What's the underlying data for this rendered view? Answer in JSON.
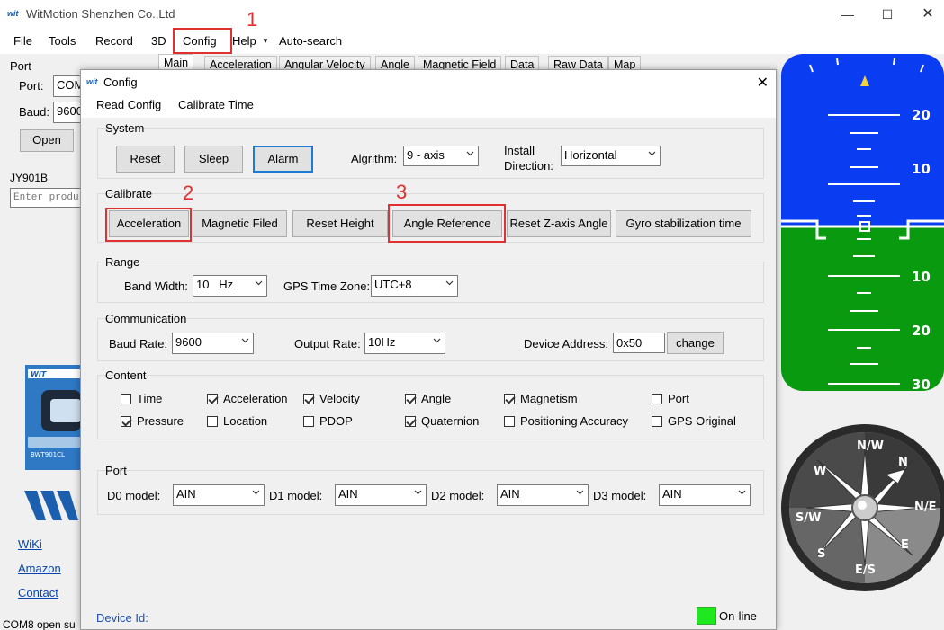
{
  "window": {
    "title": "WitMotion Shenzhen Co.,Ltd",
    "logo": "wit"
  },
  "menubar": [
    "File",
    "Tools",
    "Record",
    "3D",
    "Config",
    "Help",
    "Auto-search"
  ],
  "annotations": [
    "1",
    "2",
    "3"
  ],
  "left_panel": {
    "port_group": "Port",
    "port_label": "Port:",
    "port_value": "COM",
    "baud_label": "Baud:",
    "baud_value": "9600",
    "open_button": "Open",
    "device_name": "JY901B",
    "product_placeholder": "Enter product",
    "product_card_text": "BWT901CL",
    "links": [
      "WiKi",
      "Amazon",
      "Contact"
    ]
  },
  "tabs": [
    "Main",
    "Acceleration",
    "Angular Velocity",
    "Angle",
    "Magnetic Field",
    "Data",
    "Raw Data",
    "Map"
  ],
  "attitude": {
    "pitch_labels": [
      "20",
      "10",
      "10",
      "20",
      "30"
    ],
    "sky_color": "#0a3df2",
    "ground_color": "#0a9a10"
  },
  "compass": {
    "letters": [
      "N/W",
      "N",
      "N/E",
      "E",
      "E/S",
      "S",
      "S/W",
      "W"
    ]
  },
  "statusbar": {
    "text": "COM8 open su"
  },
  "dialog": {
    "title": "Config",
    "menu": [
      "Read Config",
      "Calibrate Time"
    ],
    "system": {
      "title": "System",
      "buttons": [
        "Reset",
        "Sleep",
        "Alarm"
      ],
      "algorithm_label": "Algrithm:",
      "algorithm_value": "9 - axis",
      "install_label_1": "Install",
      "install_label_2": "Direction:",
      "install_value": "Horizontal"
    },
    "calibrate": {
      "title": "Calibrate",
      "buttons": [
        "Acceleration",
        "Magnetic Filed",
        "Reset Height",
        "Angle Reference",
        "Reset Z-axis Angle",
        "Gyro stabilization time"
      ]
    },
    "range": {
      "title": "Range",
      "bandwidth_label": "Band Width:",
      "bandwidth_value": "10   Hz",
      "gps_tz_label": "GPS Time Zone:",
      "gps_tz_value": "UTC+8"
    },
    "communication": {
      "title": "Communication",
      "baud_label": "Baud Rate:",
      "baud_value": "9600",
      "output_label": "Output Rate:",
      "output_value": "10Hz",
      "address_label": "Device Address:",
      "address_value": "0x50",
      "change_button": "change"
    },
    "content": {
      "title": "Content",
      "items": [
        {
          "label": "Time",
          "checked": false
        },
        {
          "label": "Acceleration",
          "checked": true
        },
        {
          "label": "Velocity",
          "checked": true
        },
        {
          "label": "Angle",
          "checked": true
        },
        {
          "label": "Magnetism",
          "checked": true
        },
        {
          "label": "Port",
          "checked": false
        },
        {
          "label": "Pressure",
          "checked": true
        },
        {
          "label": "Location",
          "checked": false
        },
        {
          "label": "PDOP",
          "checked": false
        },
        {
          "label": "Quaternion",
          "checked": true
        },
        {
          "label": "Positioning Accuracy",
          "checked": false
        },
        {
          "label": "GPS Original",
          "checked": false
        }
      ]
    },
    "port": {
      "title": "Port",
      "models": [
        {
          "label": "D0 model:",
          "value": "AIN"
        },
        {
          "label": "D1 model:",
          "value": "AIN"
        },
        {
          "label": "D2 model:",
          "value": "AIN"
        },
        {
          "label": "D3 model:",
          "value": "AIN"
        }
      ]
    },
    "device_id_label": "Device Id:",
    "online_label": "On-line",
    "online_color": "#1fe81f"
  },
  "colors": {
    "highlight": "#e03030",
    "focus": "#1e7bd3",
    "link": "#0645ad"
  }
}
